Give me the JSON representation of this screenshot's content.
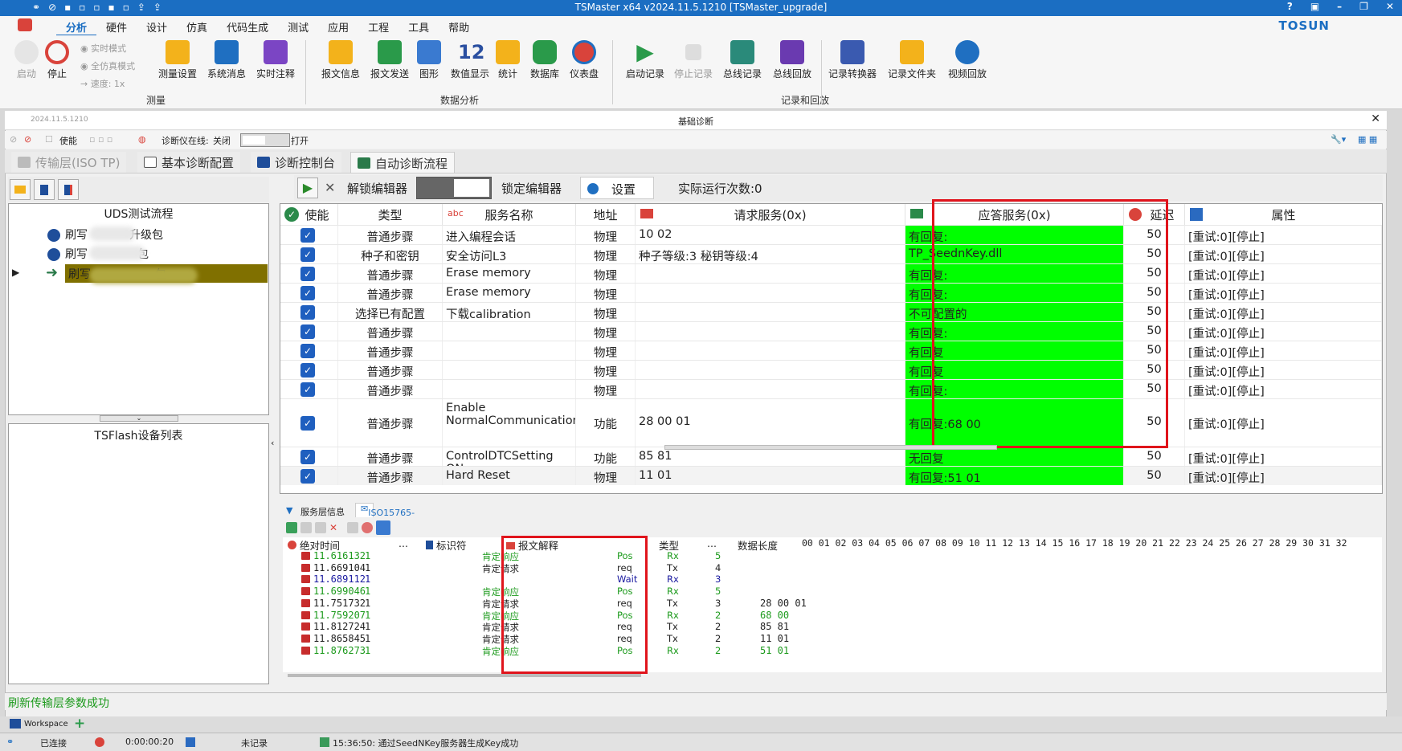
{
  "window": {
    "title": "TSMaster x64 v2024.11.5.1210 [TSMaster_upgrade]",
    "controls": {
      "help": "?",
      "restore": "▣",
      "minimize": "–",
      "maximize": "❐",
      "close": "✕"
    }
  },
  "menu": {
    "items": [
      "分析",
      "硬件",
      "设计",
      "仿真",
      "代码生成",
      "测试",
      "应用",
      "工程",
      "工具",
      "帮助"
    ],
    "active": "分析",
    "brand": "TOSUN"
  },
  "ribbon": {
    "buttons": {
      "start": "启动",
      "stop": "停止",
      "measure_setup": "测量设置",
      "system_msg": "系统消息",
      "realtime_note": "实时注释",
      "msg_info": "报文信息",
      "msg_send": "报文发送",
      "graphics": "图形",
      "numeric": "数值显示",
      "stats": "统计",
      "database": "数据库",
      "dashboard": "仪表盘",
      "start_rec": "启动记录",
      "stop_rec": "停止记录",
      "bus_rec": "总线记录",
      "bus_replay": "总线回放",
      "rec_convert": "记录转换器",
      "rec_folder": "记录文件夹",
      "video_replay": "视频回放"
    },
    "checks": {
      "realtime": "实时模式",
      "full_sim": "全仿真模式",
      "speed": "速度: 1x"
    },
    "groups": {
      "measure": "测量",
      "analysis": "数据分析",
      "record": "记录和回放"
    }
  },
  "doc": {
    "version": "2024.11.5.1210",
    "title": "基础诊断",
    "close": "✕",
    "toolbar": {
      "enable": "使能",
      "tester_online": "诊断仪在线:",
      "off": "关闭",
      "open": "打开"
    }
  },
  "tabs": [
    "传输层(ISO TP)",
    "基本诊断配置",
    "诊断控制台",
    "自动诊断流程"
  ],
  "left": {
    "tree_header": "UDS测试流程",
    "tree_items": [
      {
        "prefix": "刷写",
        "suffix": "升级包"
      },
      {
        "prefix": "刷写",
        "suffix": "包"
      },
      {
        "prefix": "刷写",
        "suffix": "包"
      }
    ],
    "device_header": "TSFlash设备列表"
  },
  "right_toolbar": {
    "unlock": "解锁编辑器",
    "lock": "锁定编辑器",
    "settings": "设置",
    "run_count": "实际运行次数:0"
  },
  "grid": {
    "headers": {
      "enable": "使能",
      "type": "类型",
      "name_icon": "abc",
      "name": "服务名称",
      "addr": "地址",
      "req": "请求服务(0x)",
      "resp": "应答服务(0x)",
      "delay": "延迟",
      "attr": "属性"
    },
    "rows": [
      {
        "type": "普通步骤",
        "name": "进入编程会话",
        "addr": "物理",
        "req": "10 02",
        "resp": "有回复:",
        "delay": "50",
        "attr": "[重试:0][停止]"
      },
      {
        "type": "种子和密钥",
        "name": "安全访问L3",
        "addr": "物理",
        "req": "种子等级:3 秘钥等级:4",
        "resp": "TP_SeednKey.dll",
        "delay": "50",
        "attr": "[重试:0][停止]"
      },
      {
        "type": "普通步骤",
        "name": "Erase memory",
        "addr": "物理",
        "req": "",
        "resp": "有回复:",
        "delay": "50",
        "attr": "[重试:0][停止]"
      },
      {
        "type": "普通步骤",
        "name": "Erase memory",
        "addr": "物理",
        "req": "",
        "resp": "有回复:",
        "delay": "50",
        "attr": "[重试:0][停止]"
      },
      {
        "type": "选择已有配置",
        "name": "下载calibration",
        "addr": "物理",
        "req": "",
        "resp": "不可配置的",
        "delay": "50",
        "attr": "[重试:0][停止]"
      },
      {
        "type": "普通步骤",
        "name": "",
        "addr": "物理",
        "req": "",
        "resp": "有回复:",
        "delay": "50",
        "attr": "[重试:0][停止]"
      },
      {
        "type": "普通步骤",
        "name": "",
        "addr": "物理",
        "req": "",
        "resp": "有回复",
        "delay": "50",
        "attr": "[重试:0][停止]"
      },
      {
        "type": "普通步骤",
        "name": "",
        "addr": "物理",
        "req": "",
        "resp": "有回复",
        "delay": "50",
        "attr": "[重试:0][停止]"
      },
      {
        "type": "普通步骤",
        "name": "",
        "addr": "物理",
        "req": "",
        "resp": "有回复:",
        "delay": "50",
        "attr": "[重试:0][停止]"
      },
      {
        "type": "普通步骤",
        "name": "Enable NormalCommunicationMessages(",
        "addr": "功能",
        "req": "28 00 01",
        "resp": "有回复:68 00",
        "delay": "50",
        "attr": "[重试:0][停止]"
      },
      {
        "type": "普通步骤",
        "name": "ControlDTCSetting ON",
        "addr": "功能",
        "req": "85 81",
        "resp": "无回复",
        "delay": "50",
        "attr": "[重试:0][停止]"
      },
      {
        "type": "普通步骤",
        "name": "Hard Reset",
        "addr": "物理",
        "req": "11 01",
        "resp": "有回复:51 01",
        "delay": "50",
        "attr": "[重试:0][停止]"
      }
    ]
  },
  "bottom": {
    "tabs": [
      "服务层信息",
      "ISO15765-2"
    ],
    "headers": {
      "time": "绝对时间",
      "dots": "...",
      "id": "标识符",
      "explain": "报文解释",
      "type": "类型",
      "dots2": "...",
      "len": "数据长度",
      "bytes": "00 01 02 03 04 05 06 07 08 09 10 11 12 13 14 15 16 17 18 19 20 21 22 23 24 25 26 27 28 29 30 31 32"
    },
    "rows": [
      {
        "time": "11.616132",
        "ch": "1",
        "explain": "肯定响应",
        "type": "Pos",
        "dir": "Rx",
        "len": "5",
        "data": "",
        "color": "#1c9a1c"
      },
      {
        "time": "11.669104",
        "ch": "1",
        "explain": "肯定请求",
        "type": "req",
        "dir": "Tx",
        "len": "4",
        "data": "",
        "color": "#222222"
      },
      {
        "time": "11.689112",
        "ch": "1",
        "explain": "",
        "type": "Wait",
        "dir": "Rx",
        "len": "3",
        "data": "",
        "color": "#1a1aa0"
      },
      {
        "time": "11.699046",
        "ch": "1",
        "explain": "肯定响应",
        "type": "Pos",
        "dir": "Rx",
        "len": "5",
        "data": "",
        "color": "#1c9a1c"
      },
      {
        "time": "11.751732",
        "ch": "1",
        "explain": "肯定请求",
        "type": "req",
        "dir": "Tx",
        "len": "3",
        "data": "28 00 01",
        "color": "#222222"
      },
      {
        "time": "11.759207",
        "ch": "1",
        "explain": "肯定响应",
        "type": "Pos",
        "dir": "Rx",
        "len": "2",
        "data": "68 00",
        "color": "#1c9a1c"
      },
      {
        "time": "11.812724",
        "ch": "1",
        "explain": "肯定请求",
        "type": "req",
        "dir": "Tx",
        "len": "2",
        "data": "85 81",
        "color": "#222222"
      },
      {
        "time": "11.865845",
        "ch": "1",
        "explain": "肯定请求",
        "type": "req",
        "dir": "Tx",
        "len": "2",
        "data": "11 01",
        "color": "#222222"
      },
      {
        "time": "11.876273",
        "ch": "1",
        "explain": "肯定响应",
        "type": "Pos",
        "dir": "Rx",
        "len": "2",
        "data": "51 01",
        "color": "#1c9a1c"
      }
    ]
  },
  "status": {
    "message": "刷新传输层参数成功",
    "workspace": "Workspace",
    "connected": "已连接",
    "elapsed": "0:00:00:20",
    "recording": "未记录",
    "log": "15:36:50: 通过SeedNKey服务器生成Key成功"
  },
  "colors": {
    "accent": "#1b6ec2",
    "response_ok": "#00ff00",
    "highlight": "#e0141c",
    "tree_selected": "#807000"
  }
}
